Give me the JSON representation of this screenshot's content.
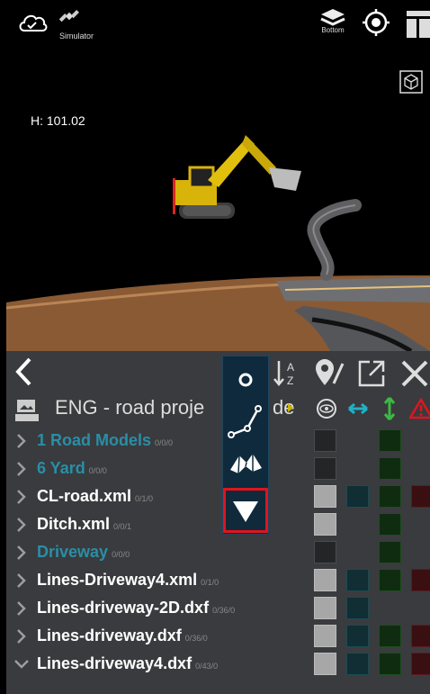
{
  "header": {
    "simulator_label": "Simulator",
    "layer_label": "Bottom",
    "height_readout": "H: 101.02"
  },
  "panel": {
    "project_title": "ENG - road proje",
    "title_suffix": "de",
    "rows": [
      {
        "name": "1 Road Models",
        "counts": "0/0/0",
        "type": "folder",
        "expanded": false,
        "vis": "off",
        "h": false,
        "v": true,
        "w": false
      },
      {
        "name": "6 Yard",
        "counts": "0/0/0",
        "type": "folder",
        "expanded": false,
        "vis": "off",
        "h": false,
        "v": true,
        "w": false
      },
      {
        "name": "CL-road.xml",
        "counts": "0/1/0",
        "type": "file",
        "expanded": false,
        "vis": "on",
        "h": true,
        "v": true,
        "w": true
      },
      {
        "name": "Ditch.xml",
        "counts": "0/0/1",
        "type": "file",
        "expanded": false,
        "vis": "on",
        "h": false,
        "v": true,
        "w": false
      },
      {
        "name": "Driveway",
        "counts": "0/0/0",
        "type": "folder",
        "expanded": false,
        "vis": "off",
        "h": false,
        "v": true,
        "w": false
      },
      {
        "name": "Lines-Driveway4.xml",
        "counts": "0/1/0",
        "type": "file",
        "expanded": false,
        "vis": "on",
        "h": true,
        "v": true,
        "w": true
      },
      {
        "name": "Lines-driveway-2D.dxf",
        "counts": "0/36/0",
        "type": "file",
        "expanded": false,
        "vis": "on",
        "h": true,
        "v": false,
        "w": false
      },
      {
        "name": "Lines-driveway.dxf",
        "counts": "0/36/0",
        "type": "file",
        "expanded": false,
        "vis": "on",
        "h": true,
        "v": true,
        "w": true
      },
      {
        "name": "Lines-driveway4.dxf",
        "counts": "0/43/0",
        "type": "file",
        "expanded": true,
        "vis": "on",
        "h": true,
        "v": true,
        "w": true
      }
    ]
  },
  "colors": {
    "folder_text": "#2a8ea6",
    "highlight": "#e0141e",
    "horizontal_arrow": "#1fb1c9",
    "vertical_arrow": "#3cb944",
    "warning": "#e0141e"
  }
}
